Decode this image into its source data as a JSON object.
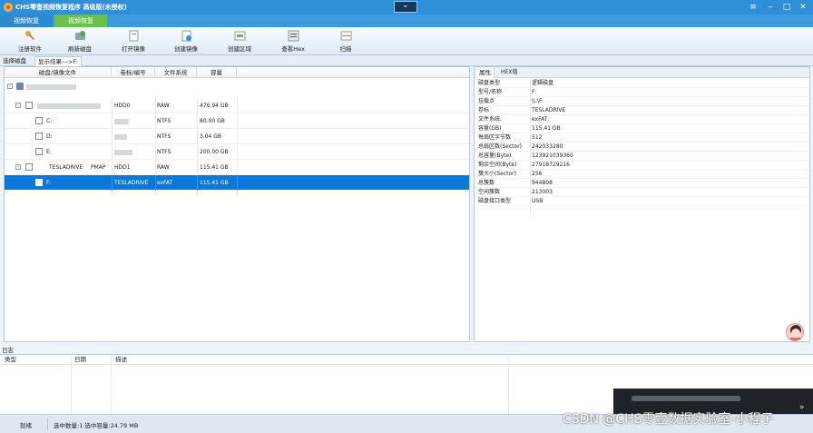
{
  "window": {
    "title": "CHS零壹视频恢复程序 高级版(未授权)"
  },
  "menu": {
    "tabs": [
      "视频恢复",
      "视频恢复"
    ]
  },
  "toolbar": {
    "buttons": [
      {
        "label": "注册软件",
        "icon": "key-icon"
      },
      {
        "label": "刷新磁盘",
        "icon": "refresh-disk-icon"
      },
      {
        "label": "打开镜像",
        "icon": "open-image-icon"
      },
      {
        "label": "创建镜像",
        "icon": "create-image-icon"
      },
      {
        "label": "创建区域",
        "icon": "create-region-icon"
      },
      {
        "label": "查看Hex",
        "icon": "hex-view-icon"
      },
      {
        "label": "扫描",
        "icon": "scan-icon"
      }
    ]
  },
  "pane": {
    "tab_disk": "选择磁盘",
    "tab_result": "显示结果--->F:"
  },
  "disklist": {
    "columns": [
      "磁盘/镜像文件",
      "卷标/编号",
      "文件系统",
      "容量"
    ],
    "rows": [
      {
        "name": "",
        "label": "HDD0",
        "fs": "RAW",
        "size": "476.94 GB"
      },
      {
        "name": "C:",
        "label": "",
        "fs": "NTFS",
        "size": "80.00 GB"
      },
      {
        "name": "D:",
        "label": "",
        "fs": "NTFS",
        "size": "3.04 GB"
      },
      {
        "name": "E:",
        "label": "",
        "fs": "NTFS",
        "size": "200.00 GB"
      },
      {
        "name": "TESLADRIVE",
        "extra": "PMAP",
        "label": "HDD1",
        "fs": "RAW",
        "size": "115.41 GB"
      },
      {
        "name": "F:",
        "label": "TESLADRIVE",
        "fs": "exFAT",
        "size": "115.41 GB"
      }
    ]
  },
  "props": {
    "tab_props": "属性",
    "tab_hex": "HEX值",
    "rows": [
      {
        "k": "磁盘类型",
        "v": "逻辑磁盘"
      },
      {
        "k": "型号/名称",
        "v": "F:"
      },
      {
        "k": "挂载点",
        "v": "\\\\.\\F:"
      },
      {
        "k": "卷标",
        "v": "TESLADRIVE"
      },
      {
        "k": "文件系统:",
        "v": "exFAT"
      },
      {
        "k": "容量(GB)",
        "v": "115.41 GB"
      },
      {
        "k": "每扇区字节数",
        "v": "512"
      },
      {
        "k": "总扇区数(Sector)",
        "v": "242033280"
      },
      {
        "k": "总容量(Byte)",
        "v": "123921039360"
      },
      {
        "k": "剩余空间(Byte)",
        "v": "27918729216"
      },
      {
        "k": "簇大小(Sector)",
        "v": "256"
      },
      {
        "k": "总簇数",
        "v": "944808"
      },
      {
        "k": "空闲簇数",
        "v": "213003"
      },
      {
        "k": "磁盘接口类型",
        "v": "USB"
      }
    ]
  },
  "log": {
    "title": "日志",
    "columns": [
      "类型",
      "日期",
      "描述"
    ]
  },
  "status": {
    "ready": "就绪",
    "selected": "选中数量:1 选中容量:24.79 MB"
  },
  "watermark": "CSDN @CHS零壹数据实验室-小程子",
  "colors": {
    "titlebar": "#2f8fd8",
    "selection": "#0a78d7",
    "active_tab": "#69c14a"
  }
}
